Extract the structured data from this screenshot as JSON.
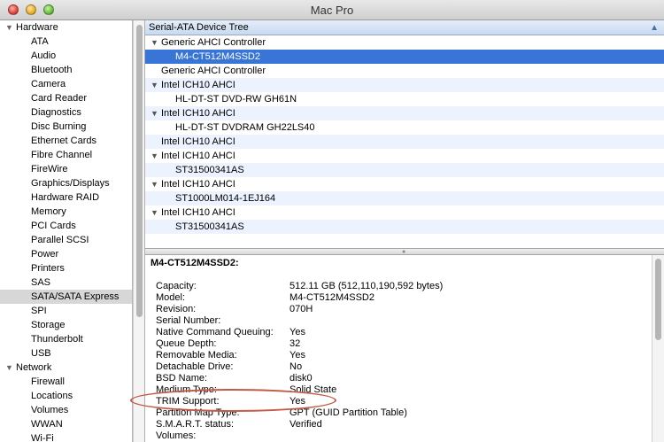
{
  "window": {
    "title": "Mac Pro"
  },
  "sidebar": {
    "categories": [
      {
        "label": "Hardware",
        "items": [
          "ATA",
          "Audio",
          "Bluetooth",
          "Camera",
          "Card Reader",
          "Diagnostics",
          "Disc Burning",
          "Ethernet Cards",
          "Fibre Channel",
          "FireWire",
          "Graphics/Displays",
          "Hardware RAID",
          "Memory",
          "PCI Cards",
          "Parallel SCSI",
          "Power",
          "Printers",
          "SAS",
          "SATA/SATA Express",
          "SPI",
          "Storage",
          "Thunderbolt",
          "USB"
        ]
      },
      {
        "label": "Network",
        "items": [
          "Firewall",
          "Locations",
          "Volumes",
          "WWAN",
          "Wi-Fi"
        ]
      }
    ],
    "selected": "SATA/SATA Express"
  },
  "tree": {
    "header": "Serial-ATA Device Tree",
    "rows": [
      {
        "label": "Generic AHCI Controller",
        "level": 0,
        "expanded": true
      },
      {
        "label": "M4-CT512M4SSD2",
        "level": 1,
        "selected": true
      },
      {
        "label": "Generic AHCI Controller",
        "level": 0
      },
      {
        "label": "Intel ICH10 AHCI",
        "level": 0,
        "expanded": true
      },
      {
        "label": "HL-DT-ST DVD-RW GH61N",
        "level": 1
      },
      {
        "label": "Intel ICH10 AHCI",
        "level": 0,
        "expanded": true
      },
      {
        "label": "HL-DT-ST DVDRAM GH22LS40",
        "level": 1
      },
      {
        "label": "Intel ICH10 AHCI",
        "level": 0
      },
      {
        "label": "Intel ICH10 AHCI",
        "level": 0,
        "expanded": true
      },
      {
        "label": "ST31500341AS",
        "level": 1
      },
      {
        "label": "Intel ICH10 AHCI",
        "level": 0,
        "expanded": true
      },
      {
        "label": "ST1000LM014-1EJ164",
        "level": 1
      },
      {
        "label": "Intel ICH10 AHCI",
        "level": 0,
        "expanded": true
      },
      {
        "label": "ST31500341AS",
        "level": 1
      }
    ]
  },
  "detail": {
    "title": "M4-CT512M4SSD2:",
    "properties": [
      {
        "label": "Capacity:",
        "value": "512.11 GB (512,110,190,592 bytes)"
      },
      {
        "label": "Model:",
        "value": "M4-CT512M4SSD2"
      },
      {
        "label": "Revision:",
        "value": "070H"
      },
      {
        "label": "Serial Number:",
        "value": ""
      },
      {
        "label": "Native Command Queuing:",
        "value": "Yes"
      },
      {
        "label": "Queue Depth:",
        "value": "32"
      },
      {
        "label": "Removable Media:",
        "value": "Yes"
      },
      {
        "label": "Detachable Drive:",
        "value": "No"
      },
      {
        "label": "BSD Name:",
        "value": "disk0"
      },
      {
        "label": "Medium Type:",
        "value": "Solid State"
      },
      {
        "label": "TRIM Support:",
        "value": "Yes"
      },
      {
        "label": "Partition Map Type:",
        "value": "GPT (GUID Partition Table)"
      },
      {
        "label": "S.M.A.R.T. status:",
        "value": "Verified"
      },
      {
        "label": "Volumes:",
        "value": ""
      }
    ],
    "highlight": "TRIM Support:"
  },
  "colors": {
    "selection": "#3875d7",
    "alt_row": "#edf3fe",
    "annotation": "#c35a46"
  },
  "icons": {
    "disclosure_open": "triangle-down-icon",
    "sort": "sort-ascending-icon"
  }
}
